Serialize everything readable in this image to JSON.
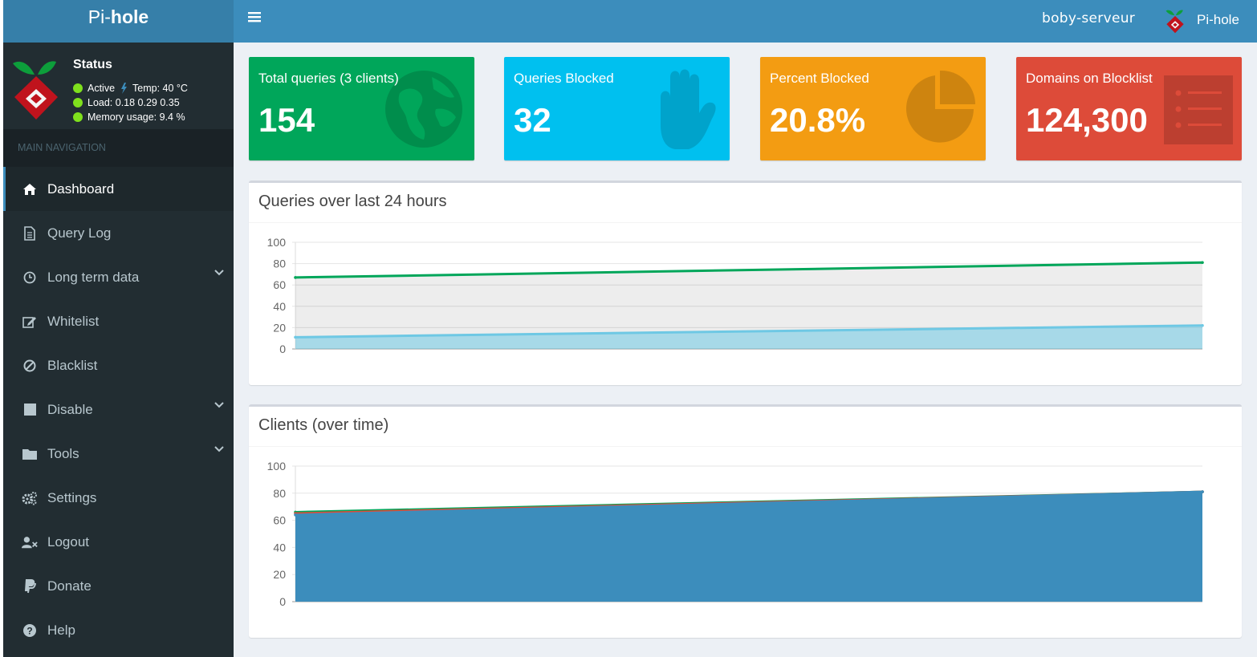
{
  "app": {
    "brand_light": "Pi-",
    "brand_bold": "hole"
  },
  "status": {
    "title": "Status",
    "active": "Active",
    "temp": "Temp: 40 °C",
    "load": "Load:  0.18  0.29  0.35",
    "memory": "Memory usage:  9.4 %"
  },
  "nav": {
    "header": "MAIN NAVIGATION",
    "items": [
      {
        "label": "Dashboard",
        "icon": "home-icon"
      },
      {
        "label": "Query Log",
        "icon": "file-icon"
      },
      {
        "label": "Long term data",
        "icon": "clock-icon"
      },
      {
        "label": "Whitelist",
        "icon": "edit-icon"
      },
      {
        "label": "Blacklist",
        "icon": "ban-icon"
      },
      {
        "label": "Disable",
        "icon": "stop-icon"
      },
      {
        "label": "Tools",
        "icon": "folder-icon"
      },
      {
        "label": "Settings",
        "icon": "gears-icon"
      },
      {
        "label": "Logout",
        "icon": "user-times-icon"
      },
      {
        "label": "Donate",
        "icon": "paypal-icon"
      },
      {
        "label": "Help",
        "icon": "question-icon"
      }
    ]
  },
  "topbar": {
    "hostname": "boby-serveur",
    "user": "Pi-hole"
  },
  "boxes": [
    {
      "label": "Total queries (3 clients)",
      "value": "154",
      "color": "#00a65a",
      "icon": "globe-icon"
    },
    {
      "label": "Queries Blocked",
      "value": "32",
      "color": "#00c0ef",
      "icon": "hand-icon"
    },
    {
      "label": "Percent Blocked",
      "value": "20.8%",
      "color": "#f39c12",
      "icon": "pie-chart-icon"
    },
    {
      "label": "Domains on Blocklist",
      "value": "124,300",
      "color": "#dd4b39",
      "icon": "list-icon"
    }
  ],
  "chart_data": [
    {
      "type": "area",
      "title": "Queries over last 24 hours",
      "ylim": [
        0,
        100
      ],
      "yticks": [
        "100",
        "80",
        "60",
        "40",
        "20",
        "0"
      ],
      "grid": true,
      "series": [
        {
          "values": [
            67,
            81
          ],
          "color": "#00a65a"
        },
        {
          "values": [
            11,
            22
          ],
          "color": "#6ec8e4"
        }
      ]
    },
    {
      "type": "area",
      "title": "Clients (over time)",
      "ylim": [
        0,
        100
      ],
      "yticks": [
        "100",
        "80",
        "60",
        "40",
        "20",
        "0"
      ],
      "grid": true,
      "series": [
        {
          "values": [
            66,
            81
          ],
          "color": "#00a65a"
        },
        {
          "values": [
            65,
            81
          ],
          "color": "#dd4b39"
        },
        {
          "values": [
            64,
            81
          ],
          "color": "#3c8dbc"
        }
      ]
    }
  ]
}
